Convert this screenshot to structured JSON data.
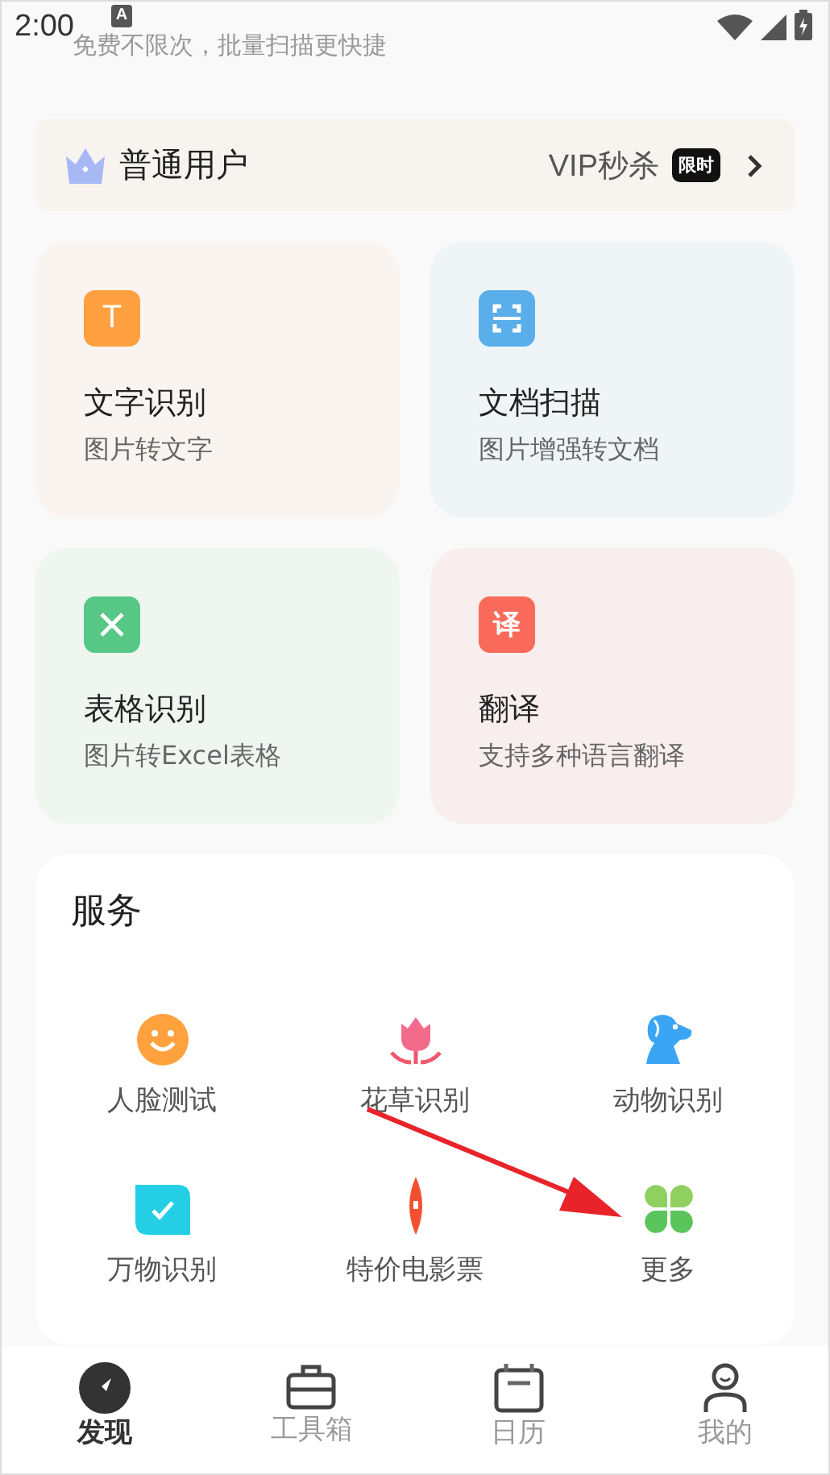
{
  "status_bar": {
    "time": "2:00",
    "notification": "A"
  },
  "subtitle": "免费不限次，批量扫描更快捷",
  "membership": {
    "label": "普通用户",
    "promo": "VIP秒杀",
    "badge": "限时"
  },
  "features": [
    {
      "kind": "text",
      "title": "文字识别",
      "subtitle": "图片转文字",
      "icon_text": "T"
    },
    {
      "kind": "scan",
      "title": "文档扫描",
      "subtitle": "图片增强转文档"
    },
    {
      "kind": "table",
      "title": "表格识别",
      "subtitle": "图片转Excel表格"
    },
    {
      "kind": "translate",
      "title": "翻译",
      "subtitle": "支持多种语言翻译",
      "icon_text": "译"
    }
  ],
  "services": {
    "title": "服务",
    "items": [
      {
        "kind": "face",
        "label": "人脸测试"
      },
      {
        "kind": "flower",
        "label": "花草识别"
      },
      {
        "kind": "dog",
        "label": "动物识别"
      },
      {
        "kind": "check",
        "label": "万物识别"
      },
      {
        "kind": "ticket",
        "label": "特价电影票"
      },
      {
        "kind": "clover",
        "label": "更多"
      }
    ]
  },
  "nav": [
    {
      "kind": "compass",
      "label": "发现",
      "selected": true
    },
    {
      "kind": "toolbox",
      "label": "工具箱",
      "selected": false
    },
    {
      "kind": "calendar",
      "label": "日历",
      "selected": false
    },
    {
      "kind": "person",
      "label": "我的",
      "selected": false
    }
  ]
}
